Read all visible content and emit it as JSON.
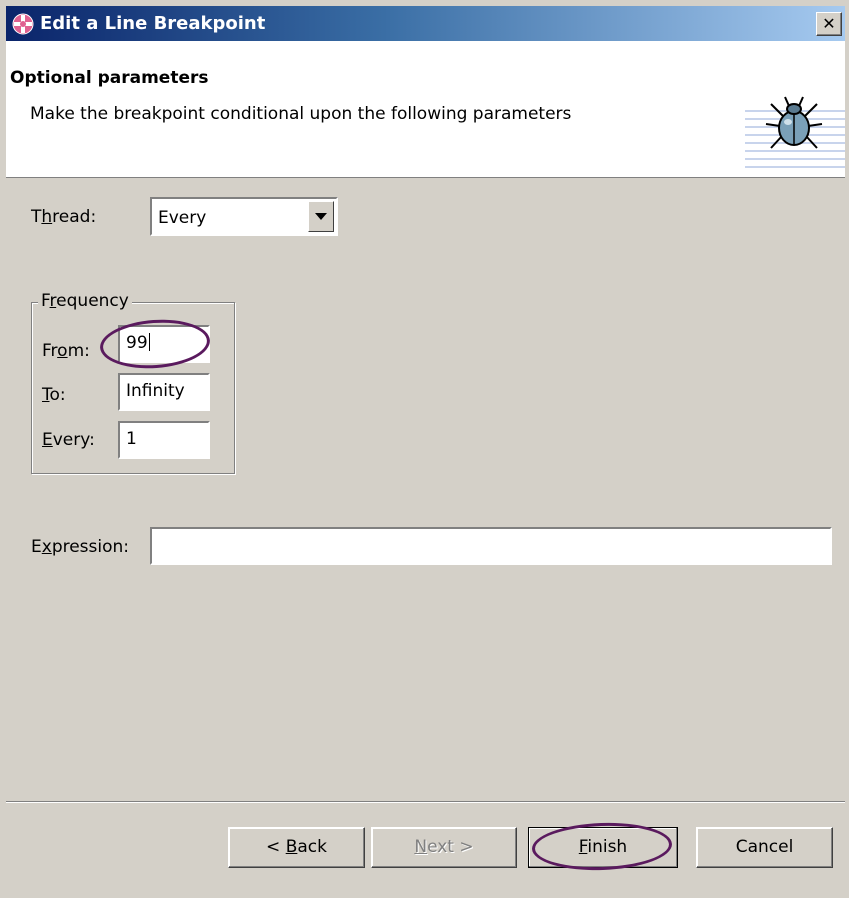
{
  "window": {
    "title": "Edit a Line Breakpoint",
    "close_glyph": "✕",
    "title_icon": "debug-perspective-icon"
  },
  "header": {
    "title": "Optional parameters",
    "description": "Make the breakpoint conditional upon the following parameters",
    "banner_icon": "bug-icon"
  },
  "thread": {
    "label_pre": "T",
    "label_mnemonic": "h",
    "label_post": "read:",
    "value": "Every"
  },
  "frequency": {
    "legend_pre": "F",
    "legend_mnemonic": "r",
    "legend_post": "equency",
    "from_pre": "Fr",
    "from_mnemonic": "o",
    "from_post": "m:",
    "from_value": "99",
    "to_mnemonic": "T",
    "to_post": "o:",
    "to_value": "Infinity",
    "every_mnemonic": "E",
    "every_post": "very:",
    "every_value": "1"
  },
  "expression": {
    "label_pre": "E",
    "label_mnemonic": "x",
    "label_post": "pression:",
    "value": ""
  },
  "buttons": {
    "back_pre": "< ",
    "back_mnemonic": "B",
    "back_post": "ack",
    "next_mnemonic": "N",
    "next_post": "ext >",
    "finish_mnemonic": "F",
    "finish_post": "inish",
    "cancel": "Cancel"
  },
  "colors": {
    "titlebar_start": "#0a246a",
    "titlebar_end": "#a6caf0",
    "dialog_face": "#d4d0c8",
    "annotation_oval": "#5a1a5e"
  }
}
